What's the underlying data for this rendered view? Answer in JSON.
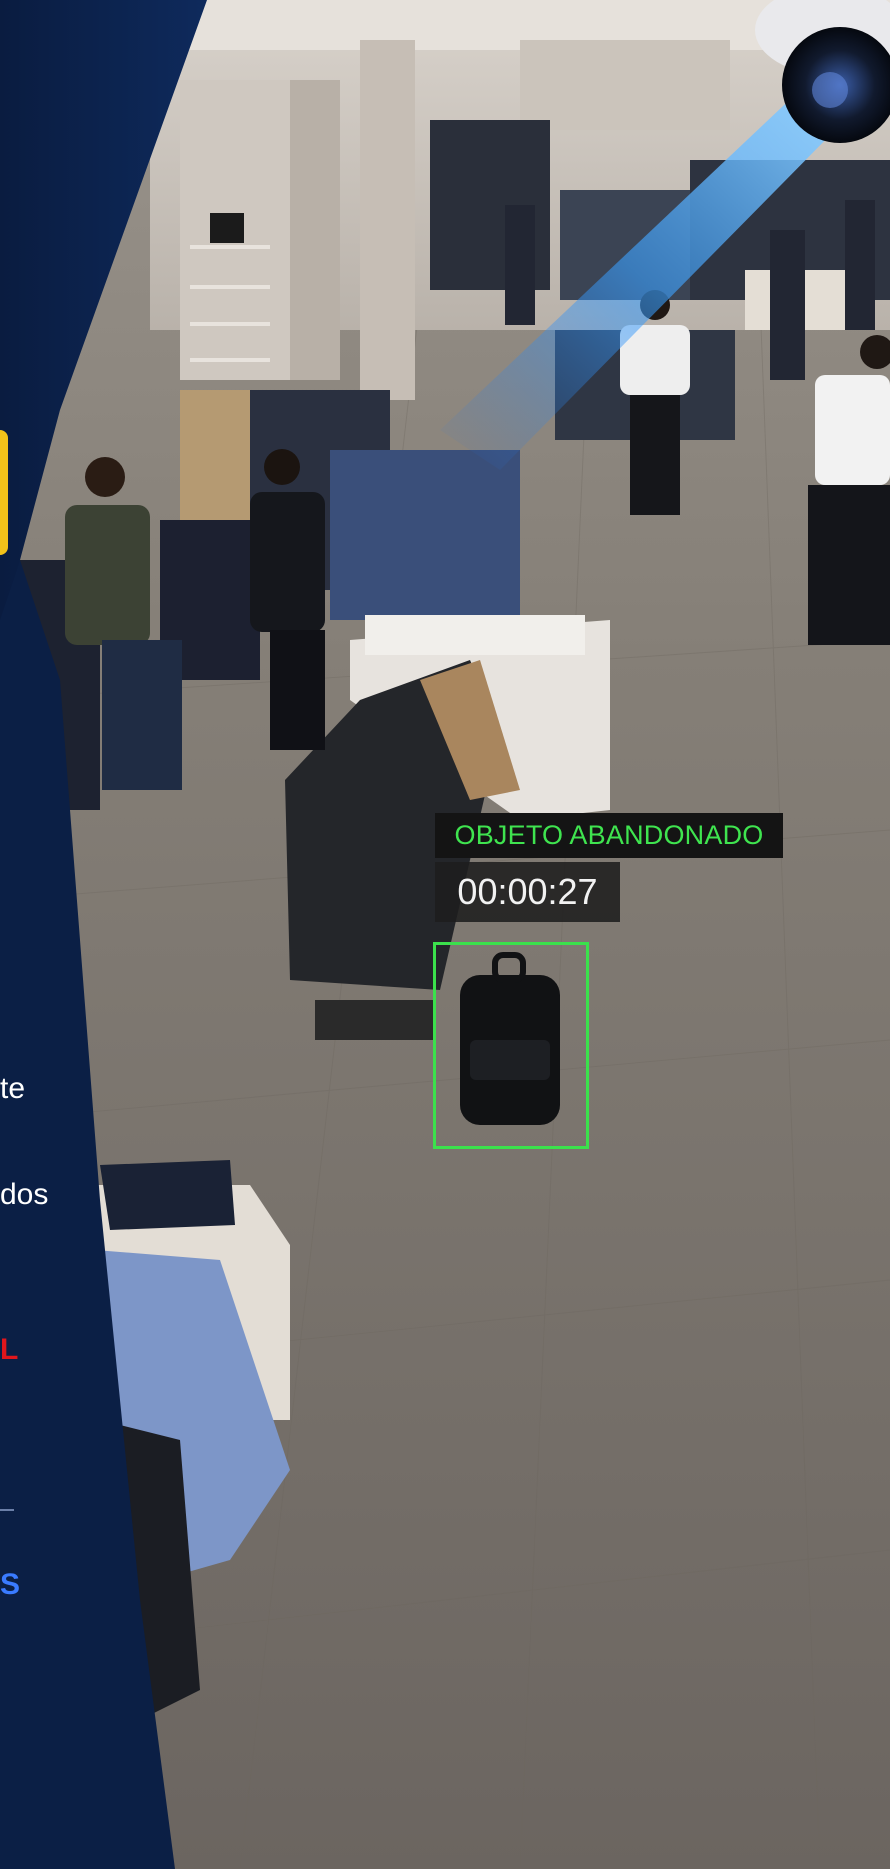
{
  "scene": {
    "description_free": true
  },
  "overlay": {
    "alert_label": "OBJETO ABANDONADO",
    "alert_timer": "00:00:27",
    "label_text_color": "#3fe44f",
    "box_color": "#3be14c"
  },
  "panel": {
    "color": "#0c2147",
    "fragments": {
      "f1": "te",
      "f2": "dos",
      "f3": "L",
      "f4": "S"
    }
  },
  "colors": {
    "floor": "#7a736c",
    "panel_dark": "#0b1f45",
    "beam": "#3aa0ff"
  }
}
